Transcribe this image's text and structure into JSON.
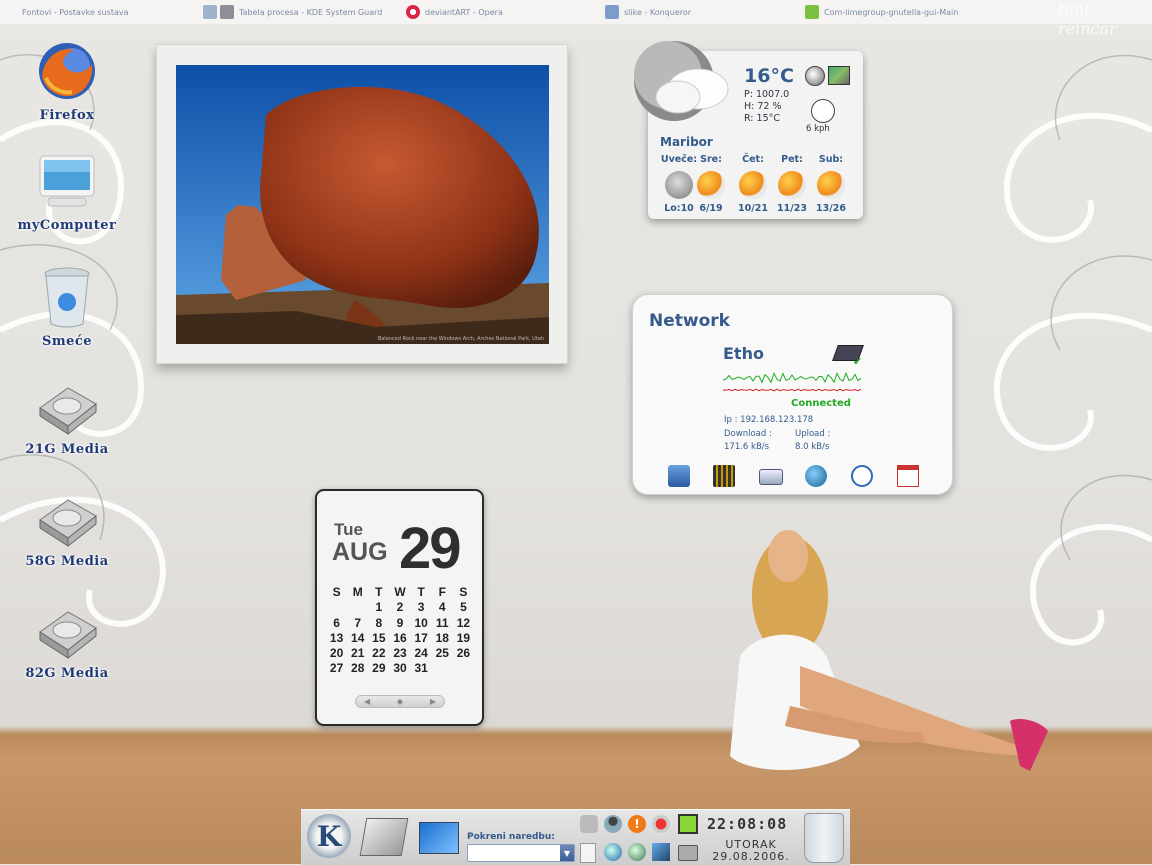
{
  "taskbar": {
    "tasks": [
      {
        "label": "Fontovi - Postavke sustava"
      },
      {
        "label": "Tabela procesa - KDE System Guard"
      },
      {
        "label": "deviantART - Opera"
      },
      {
        "label": "slike - Konqueror"
      },
      {
        "label": "Com-limegroup-gnutella-gui-Main"
      }
    ]
  },
  "wall_text": "tant reincar",
  "desktop_icons": [
    {
      "label": "Firefox",
      "icon": "firefox-icon"
    },
    {
      "label": "myComputer",
      "icon": "monitor-icon"
    },
    {
      "label": "Smeće",
      "icon": "trash-icon"
    },
    {
      "label": "21G Media",
      "icon": "hard-drive-icon"
    },
    {
      "label": "58G Media",
      "icon": "hard-drive-icon"
    },
    {
      "label": "82G Media",
      "icon": "hard-drive-icon"
    }
  ],
  "photo": {
    "caption": "Balanced Rock near the Windows Arch, Arches National Park, Utah"
  },
  "weather": {
    "temp": "16°C",
    "pressure": "P: 1007.0",
    "humidity": "H: 72 %",
    "realfeel": "R: 15°C",
    "wind": "6 kph",
    "city": "Maribor",
    "forecast": [
      {
        "day": "Uveče:",
        "temps": "Lo:10",
        "icon": "cloudy-night-icon"
      },
      {
        "day": "Sre:",
        "temps": "6/19",
        "icon": "partly-sunny-icon"
      },
      {
        "day": "Čet:",
        "temps": "10/21",
        "icon": "partly-sunny-icon"
      },
      {
        "day": "Pet:",
        "temps": "11/23",
        "icon": "partly-sunny-icon"
      },
      {
        "day": "Sub:",
        "temps": "13/26",
        "icon": "partly-sunny-icon"
      }
    ]
  },
  "network": {
    "title": "Network",
    "interface": "Etho",
    "status": "Connected",
    "ip": "Ip : 192.168.123.178",
    "download_label": "Download :",
    "download_value": "171.6 kB/s",
    "upload_label": "Upload :",
    "upload_value": "8.0 kB/s",
    "colors": {
      "download": "#22aa22",
      "upload": "#cc2222"
    }
  },
  "calendar": {
    "dow": "Tue",
    "month": "AUG",
    "day": "29",
    "headers": [
      "S",
      "M",
      "T",
      "W",
      "T",
      "F",
      "S"
    ],
    "weeks": [
      [
        "",
        "",
        "1",
        "2",
        "3",
        "4",
        "5"
      ],
      [
        "6",
        "7",
        "8",
        "9",
        "10",
        "11",
        "12"
      ],
      [
        "13",
        "14",
        "15",
        "16",
        "17",
        "18",
        "19"
      ],
      [
        "20",
        "21",
        "22",
        "23",
        "24",
        "25",
        "26"
      ],
      [
        "27",
        "28",
        "29",
        "30",
        "31",
        "",
        ""
      ]
    ],
    "nav": {
      "prev": "◀",
      "today": "◆",
      "next": "▶"
    }
  },
  "panel": {
    "run_label": "Pokreni naredbu:",
    "run_value": "",
    "time": "22:08:08",
    "weekday": "UTORAK",
    "date": "29.08.2006."
  }
}
